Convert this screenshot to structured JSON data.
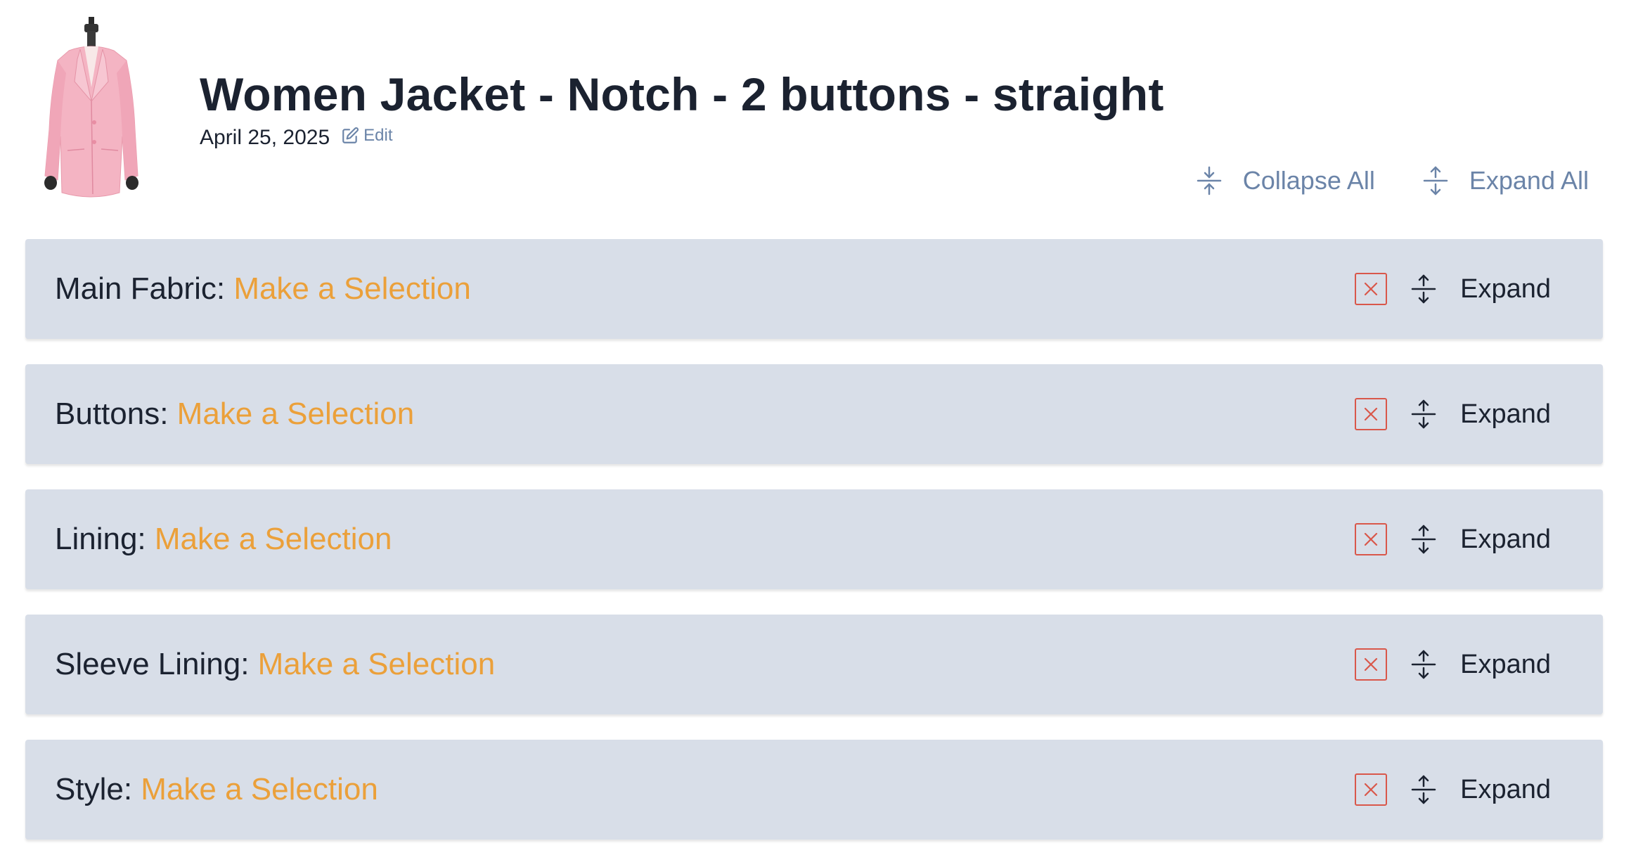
{
  "header": {
    "title": "Women Jacket - Notch - 2 buttons - straight",
    "date": "April 25, 2025",
    "edit_label": "Edit",
    "collapse_all_label": "Collapse All",
    "expand_all_label": "Expand All",
    "image_alt": "Pink women jacket on mannequin"
  },
  "colors": {
    "accent_blue": "#6b84a8",
    "selection_orange": "#eba03a",
    "clear_red": "#d9574a",
    "section_bg": "#d8dee8"
  },
  "sections": [
    {
      "label": "Main Fabric:",
      "value": "Make a Selection",
      "expand_label": "Expand"
    },
    {
      "label": "Buttons:",
      "value": "Make a Selection",
      "expand_label": "Expand"
    },
    {
      "label": "Lining:",
      "value": "Make a Selection",
      "expand_label": "Expand"
    },
    {
      "label": "Sleeve Lining:",
      "value": "Make a Selection",
      "expand_label": "Expand"
    },
    {
      "label": "Style:",
      "value": "Make a Selection",
      "expand_label": "Expand"
    }
  ]
}
